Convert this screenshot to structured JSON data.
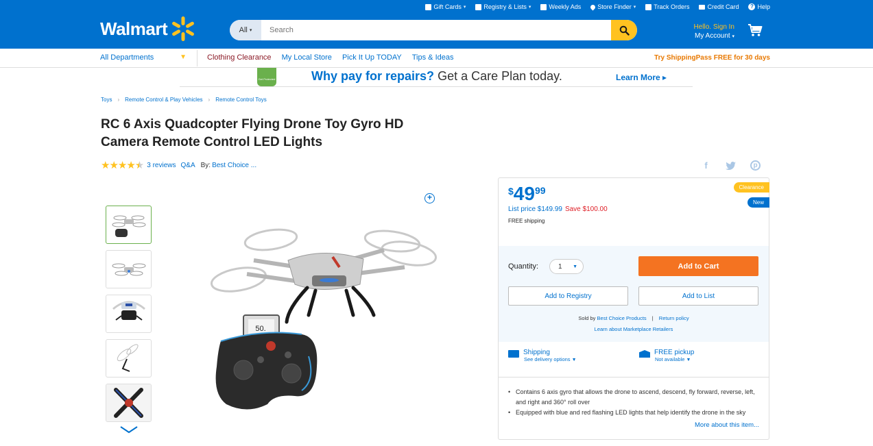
{
  "header": {
    "logo_text": "Walmart",
    "util_links": [
      {
        "label": "Gift Cards",
        "icon": "gift-icon",
        "caret": true
      },
      {
        "label": "Registry & Lists",
        "icon": "registry-icon",
        "caret": true
      },
      {
        "label": "Weekly Ads",
        "icon": "weekly-ads-icon",
        "caret": false
      },
      {
        "label": "Store Finder",
        "icon": "location-pin-icon",
        "caret": true
      },
      {
        "label": "Track Orders",
        "icon": "track-orders-icon",
        "caret": false
      },
      {
        "label": "Credit Card",
        "icon": "credit-card-icon",
        "caret": false
      },
      {
        "label": "Help",
        "icon": "help-icon",
        "caret": false
      }
    ],
    "search_scope": "All",
    "search_placeholder": "Search",
    "account_hello": "Hello. Sign In",
    "account_label": "My Account",
    "colors": {
      "brand_blue": "#0071ce",
      "spark_yellow": "#ffc220"
    }
  },
  "nav": {
    "departments": "All Departments",
    "links": [
      "Clothing Clearance",
      "My Local Store",
      "Pick It Up TODAY",
      "Tips & Ideas"
    ],
    "shipping_promo": "Try ShippingPass FREE for 30 days"
  },
  "banner": {
    "badge_text": "Get Protected",
    "headline": "Why pay for repairs?",
    "subline": "Get a Care Plan today.",
    "cta": "Learn More"
  },
  "breadcrumb": [
    "Toys",
    "Remote Control & Play Vehicles",
    "Remote Control Toys"
  ],
  "product": {
    "title": "RC 6 Axis Quadcopter Flying Drone Toy Gyro HD Camera Remote Control LED Lights",
    "rating": 4.5,
    "reviews": "3 reviews",
    "qa": "Q&A",
    "by_label": "By:",
    "brand": "Best Choice ...",
    "thumbnail_count": 5,
    "remote_display": "50."
  },
  "buybox": {
    "price_symbol": "$",
    "price_dollars": "49",
    "price_cents": "99",
    "list_price": "List price $149.99",
    "save": "Save $100.00",
    "free_shipping": "FREE shipping",
    "tag_clearance": "Clearance",
    "tag_new": "New",
    "quantity_label": "Quantity:",
    "quantity_value": "1",
    "add_to_cart": "Add to Cart",
    "add_to_registry": "Add to Registry",
    "add_to_list": "Add to List",
    "sold_by_prefix": "Sold by",
    "seller": "Best Choice Products",
    "return_policy": "Return policy",
    "marketplace": "Learn about Marketplace Retailers",
    "shipping_title": "Shipping",
    "shipping_sub": "See delivery options",
    "pickup_title": "FREE pickup",
    "pickup_sub": "Not available",
    "bullets": [
      "Contains 6 axis gyro that allows the drone to ascend, descend, fly forward, reverse, left, and right and 360° roll over",
      "Equipped with blue and red flashing LED lights that help identify the drone in the sky"
    ],
    "more_link": "More about this item..."
  }
}
